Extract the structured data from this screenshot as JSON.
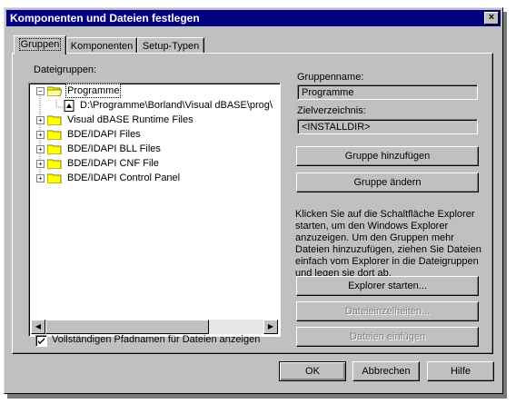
{
  "window": {
    "title": "Komponenten und Dateien festlegen"
  },
  "tabs": [
    "Gruppen",
    "Komponenten",
    "Setup-Typen"
  ],
  "left": {
    "label": "Dateigruppen:",
    "tree": [
      {
        "label": "Programme",
        "expanded": true,
        "selected": true
      },
      {
        "label": "D:\\Programme\\Borland\\Visual dBASE\\prog\\",
        "file": true
      },
      {
        "label": "Visual dBASE Runtime Files"
      },
      {
        "label": "BDE/IDAPI Files"
      },
      {
        "label": "BDE/IDAPI BLL Files"
      },
      {
        "label": "BDE/IDAPI CNF File"
      },
      {
        "label": "BDE/IDAPI Control Panel"
      }
    ],
    "checkbox_label": "Vollständigen Pfadnamen für Dateien anzeigen",
    "checkbox_checked": true
  },
  "right": {
    "group_name_label": "Gruppenname:",
    "group_name_value": "Programme",
    "target_label": "Zielverzeichnis:",
    "target_value": "<INSTALLDIR>",
    "add_group": "Gruppe hinzufügen",
    "change_group": "Gruppe ändern",
    "description": "Klicken Sie auf die Schaltfläche Explorer starten, um den Windows Explorer anzuzeigen. Um den Gruppen mehr Dateien hinzuzufügen, ziehen Sie Dateien einfach vom Explorer in die Dateigruppen und legen sie dort ab.",
    "explorer_start": "Explorer starten...",
    "file_details": "Dateieinzelheiten...",
    "insert_files": "Dateien einfügen"
  },
  "footer": {
    "ok": "OK",
    "cancel": "Abbrechen",
    "help": "Hilfe"
  }
}
